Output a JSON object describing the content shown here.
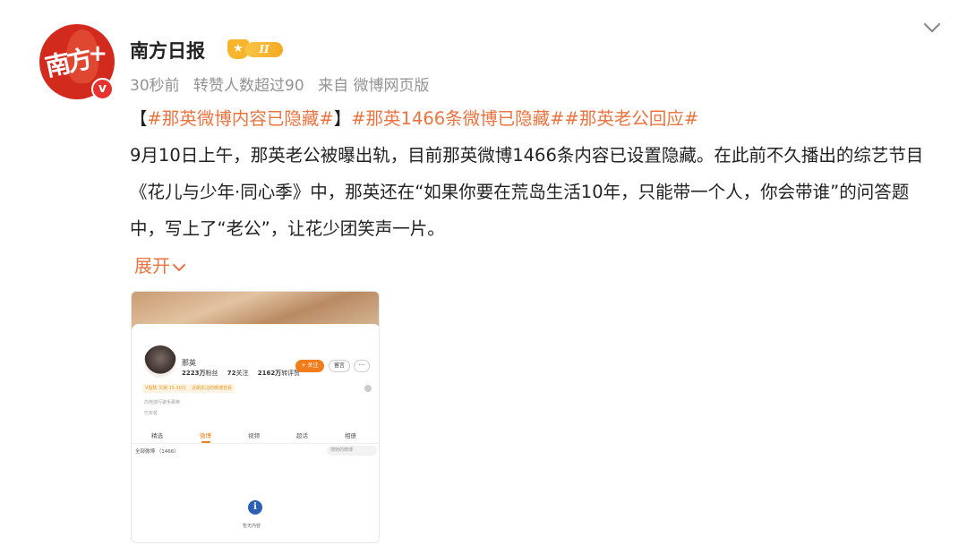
{
  "author": {
    "name": "南方日报",
    "avatar_text": "南方",
    "avatar_plus": "+",
    "verify_mark": "v",
    "level_icon": "crown-icon",
    "level_label": "II"
  },
  "meta": {
    "time": "30秒前",
    "reposts": "转赞人数超过90",
    "source": "来自 微博网页版"
  },
  "post": {
    "tags_line_prefix": "【",
    "tag1": "#那英微博内容已隐藏#",
    "tags_line_mid": "】",
    "tag2": "#那英1466条微博已隐藏#",
    "tag3": "#那英老公回应#",
    "body": "9月10日上午，那英老公被曝出轨，目前那英微博1466条内容已设置隐藏。在此前不久播出的综艺节目《花儿与少年·同心季》中，那英还在“如果你要在荒岛生活10年，只能带一个人，你会带谁”的问答题中，写上了“老公”，让花少团笑声一片。",
    "expand_label": "展开"
  },
  "thumbnail": {
    "name": "那英",
    "followers": "2223万",
    "followers_label": "粉丝",
    "following": "72",
    "following_label": "关注",
    "likes": "2162万",
    "likes_label": "转评赞",
    "follow_btn": "+ 关注",
    "msg_btn": "留言",
    "more_btn": "···",
    "chip1": "V指数 文娱 15.30分",
    "chip2": "近期关注的微博查看",
    "info1": "内地流行歌手那英",
    "info2": "已实名",
    "tabs": [
      "精选",
      "微博",
      "视频",
      "相册",
      "相册"
    ],
    "tab_labels": [
      "精选",
      "微博",
      "视频",
      "超话",
      "相册"
    ],
    "filter": "全部微博 （1466）",
    "search_placeholder": "搜她的微博",
    "empty_icon": "i",
    "empty_text": "暂无内容"
  },
  "colors": {
    "tag": "#eb7340",
    "meta": "#939393",
    "brand_red": "#d32a1e"
  }
}
